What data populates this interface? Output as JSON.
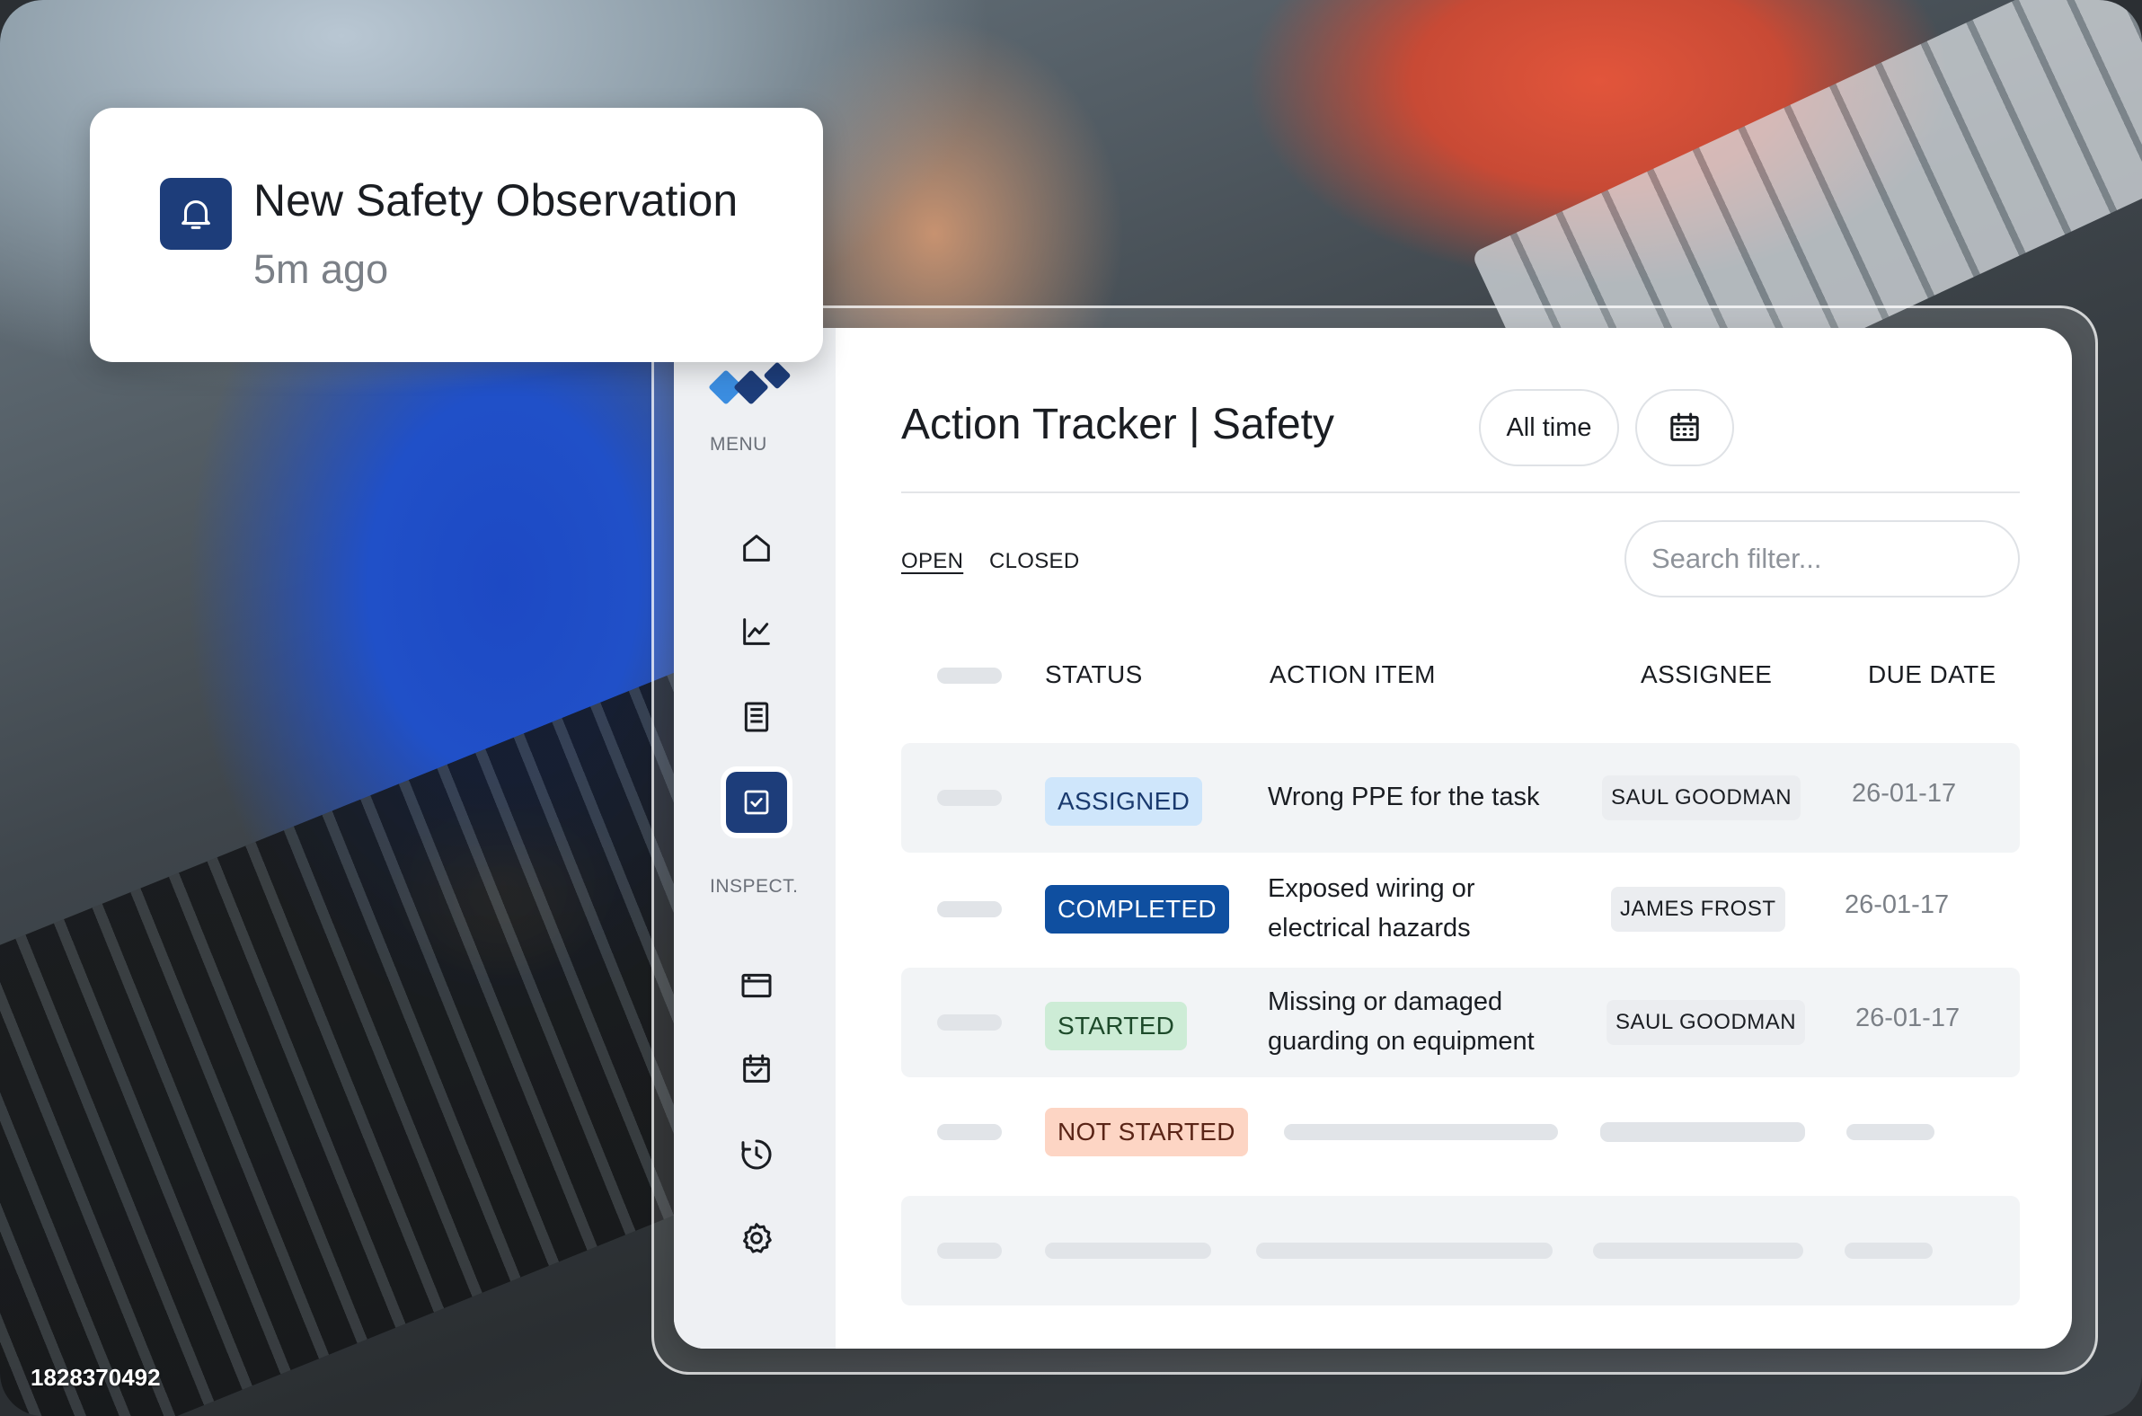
{
  "photo_id": "1828370492",
  "notification": {
    "title": "New Safety Observation",
    "time": "5m ago",
    "icon": "bell-icon"
  },
  "sidebar": {
    "menu_label": "MENU",
    "inspect_label": "INSPECT.",
    "menu_items": [
      {
        "icon": "home-icon"
      },
      {
        "icon": "chart-icon"
      },
      {
        "icon": "document-icon"
      },
      {
        "icon": "checkbox-icon",
        "active": true
      }
    ],
    "inspect_items": [
      {
        "icon": "window-icon"
      },
      {
        "icon": "calendar-check-icon"
      },
      {
        "icon": "clock-history-icon"
      },
      {
        "icon": "gear-icon"
      }
    ]
  },
  "header": {
    "title": "Action Tracker | Safety",
    "time_filter": "All time",
    "calendar_icon": "calendar-icon"
  },
  "tabs": [
    {
      "label": "OPEN",
      "active": true
    },
    {
      "label": "CLOSED",
      "active": false
    }
  ],
  "search": {
    "placeholder": "Search filter..."
  },
  "table": {
    "columns": [
      "STATUS",
      "ACTION ITEM",
      "ASSIGNEE",
      "DUE DATE"
    ],
    "rows": [
      {
        "status": "ASSIGNED",
        "action_line1": "Wrong PPE for the task",
        "action_line2": "",
        "assignee": "SAUL GOODMAN",
        "due": "26-01-17"
      },
      {
        "status": "COMPLETED",
        "action_line1": "Exposed wiring or",
        "action_line2": "electrical hazards",
        "assignee": "JAMES FROST",
        "due": "26-01-17"
      },
      {
        "status": "STARTED",
        "action_line1": "Missing or damaged",
        "action_line2": "guarding on equipment",
        "assignee": "SAUL GOODMAN",
        "due": "26-01-17"
      },
      {
        "status": "NOT STARTED",
        "action_line1": "",
        "action_line2": "",
        "assignee": "",
        "due": ""
      }
    ]
  },
  "colors": {
    "brand_navy": "#1d3d7a",
    "assigned_bg": "#cfe6fb",
    "completed_bg": "#0f4fa0",
    "started_bg": "#cdecd6",
    "not_started_bg": "#fdd5c4"
  }
}
